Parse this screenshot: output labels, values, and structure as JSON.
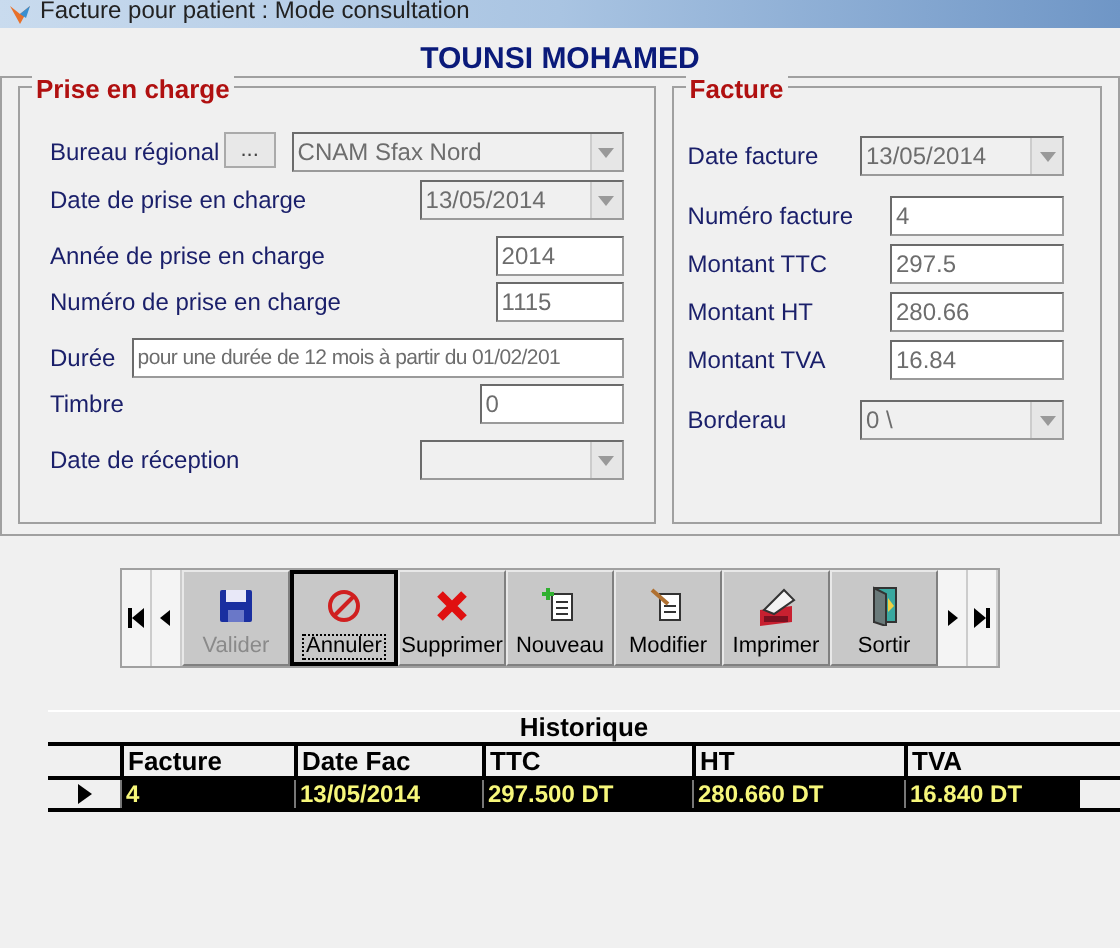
{
  "window": {
    "title": "Facture pour patient  : Mode consultation"
  },
  "patient_name": "TOUNSI MOHAMED",
  "prise_en_charge": {
    "title": "Prise en charge",
    "fields": [
      {
        "label": "Bureau régional",
        "kind": "lookup",
        "button": "...",
        "value": "CNAM Sfax Nord"
      },
      {
        "label": "Date de prise en charge",
        "kind": "combo",
        "value": "13/05/2014"
      },
      {
        "label": "Année de prise en charge",
        "kind": "text",
        "value": "2014"
      },
      {
        "label": "Numéro de prise en charge",
        "kind": "text",
        "value": "1115"
      },
      {
        "label": "Durée",
        "kind": "wide",
        "value": "pour une durée de 12 mois à partir du 01/02/201"
      },
      {
        "label": "Timbre",
        "kind": "text",
        "value": "0"
      },
      {
        "label": "Date de réception",
        "kind": "combo"
      }
    ]
  },
  "facture": {
    "title": "Facture",
    "fields": [
      {
        "label": "Date facture",
        "kind": "combo",
        "value": "13/05/2014"
      },
      {
        "label": "Numéro facture",
        "kind": "text",
        "value": "4"
      },
      {
        "label": "Montant TTC",
        "kind": "text",
        "value": "297.5"
      },
      {
        "label": "Montant HT",
        "kind": "text",
        "value": "280.66"
      },
      {
        "label": "Montant TVA",
        "kind": "text",
        "value": "16.84"
      },
      {
        "label": "Borderau",
        "kind": "combo",
        "value": "0 \\"
      }
    ]
  },
  "toolbar": [
    {
      "label": "Valider",
      "kind": "save",
      "disabled": true,
      "focused": false
    },
    {
      "label": "Annuler",
      "kind": "cancel",
      "disabled": false,
      "focused": true
    },
    {
      "label": "Supprimer",
      "kind": "delete",
      "disabled": false,
      "focused": false
    },
    {
      "label": "Nouveau",
      "kind": "new",
      "disabled": false,
      "focused": false
    },
    {
      "label": "Modifier",
      "kind": "edit",
      "disabled": false,
      "focused": false
    },
    {
      "label": "Imprimer",
      "kind": "print",
      "disabled": false,
      "focused": false
    },
    {
      "label": "Sortir",
      "kind": "exit",
      "disabled": false,
      "focused": false
    }
  ],
  "historique": {
    "title": "Historique",
    "columns": [
      "Facture",
      "Date Fac",
      "TTC",
      "HT",
      "TVA"
    ],
    "rows": [
      {
        "selected": true,
        "cells": [
          "4",
          "13/05/2014",
          "297.500 DT",
          "280.660 DT",
          "16.840 DT"
        ]
      }
    ]
  }
}
